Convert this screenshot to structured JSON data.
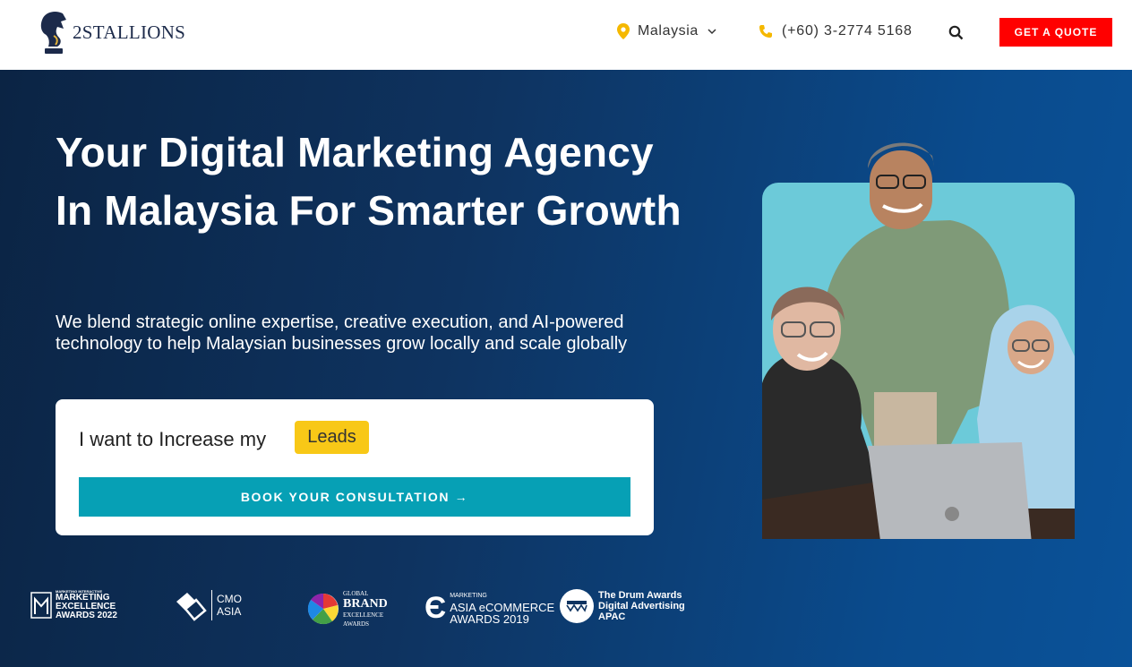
{
  "header": {
    "logo_text": "2STALLIONS",
    "country": "Malaysia",
    "phone": "(+60) 3-2774 5168",
    "quote_label": "GET A QUOTE"
  },
  "hero": {
    "title": "Your Digital Marketing Agency In Malaysia For Smarter Growth",
    "subtitle": "We blend strategic online expertise, creative execution, and AI-powered technology to help Malaysian businesses grow locally and scale globally",
    "lead_prefix": "I want to Increase my",
    "lead_value": "Leads",
    "cta_label": "BOOK YOUR CONSULTATION →"
  },
  "awards": [
    {
      "small": "MARKETING INTERACTIVE",
      "line1": "MARKETING",
      "line2": "EXCELLENCE",
      "line3": "AWARDS 2022"
    },
    {
      "line1": "CMO",
      "line2": "ASIA"
    },
    {
      "small": "GLOBAL",
      "line1": "BRAND",
      "line2": "EXCELLENCE",
      "line3": "AWARDS"
    },
    {
      "small": "MARKETING",
      "line1": "ASIA eCOMMERCE",
      "line2": "AWARDS 2019"
    },
    {
      "line1": "The Drum Awards",
      "line2": "Digital Advertising",
      "line3": "APAC"
    }
  ],
  "colors": {
    "accent_red": "#ff0000",
    "cta_teal": "#06a0b5",
    "badge_yellow": "#f8c817",
    "hero_navy": "#0b2444",
    "photo_bg": "#6ccad9"
  },
  "icons": [
    "stallion-logo-icon",
    "map-pin-icon",
    "chevron-down-icon",
    "phone-icon",
    "search-icon"
  ]
}
